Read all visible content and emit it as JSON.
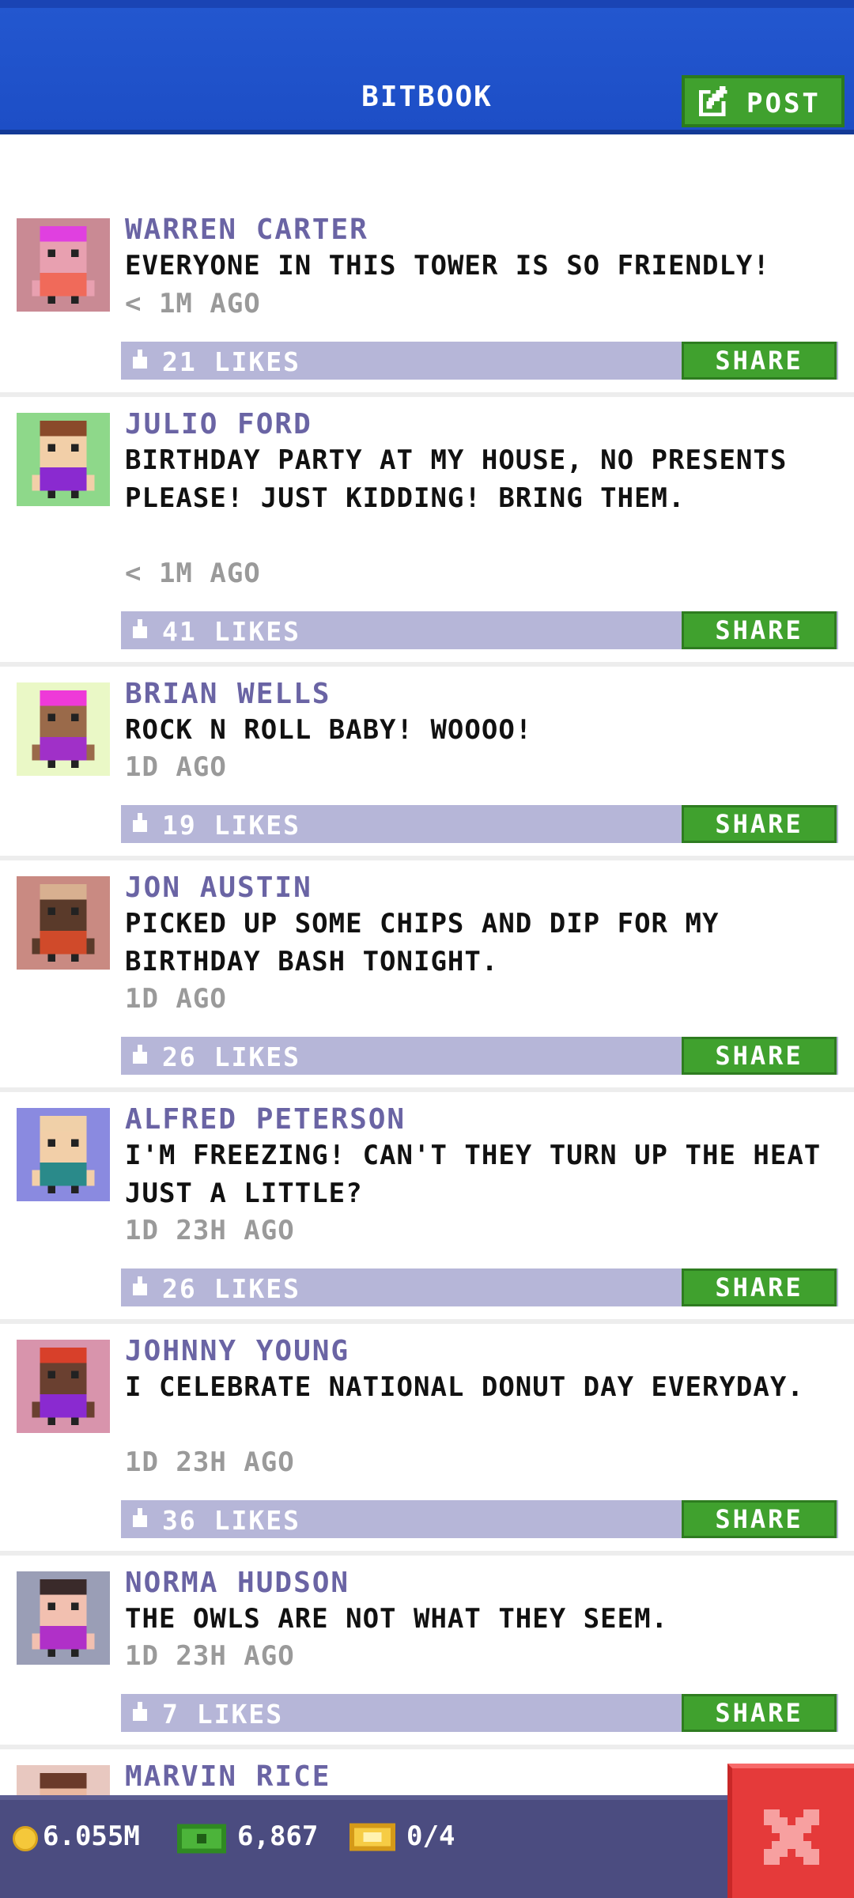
{
  "header": {
    "title": "BITBOOK",
    "post_button_label": "POST"
  },
  "posts": [
    {
      "name": "WARREN CARTER",
      "text": "EVERYONE IN THIS TOWER IS SO FRIENDLY!",
      "time": "< 1M AGO",
      "likes": "21 LIKES",
      "share": "SHARE",
      "avatar_bg": "#c98a94",
      "hair": "#e040e0",
      "shirt": "#f06a5a",
      "skin": "#e8a0b0"
    },
    {
      "name": "JULIO FORD",
      "text": "BIRTHDAY PARTY AT MY HOUSE, NO PRESENTS PLEASE! JUST KIDDING! BRING THEM.",
      "time": "< 1M AGO",
      "likes": "41 LIKES",
      "share": "SHARE",
      "avatar_bg": "#8ed88a",
      "hair": "#8a4a2a",
      "shirt": "#8a2ad0",
      "skin": "#f2cfa8"
    },
    {
      "name": "BRIAN WELLS",
      "text": "ROCK N ROLL BABY! WOOOO!",
      "time": "1D AGO",
      "likes": "19 LIKES",
      "share": "SHARE",
      "avatar_bg": "#eaf8c6",
      "hair": "#ee3ad8",
      "shirt": "#a030c8",
      "skin": "#9a6a4a"
    },
    {
      "name": "JON AUSTIN",
      "text": "PICKED UP SOME CHIPS AND DIP FOR MY BIRTHDAY BASH TONIGHT.",
      "time": "1D AGO",
      "likes": "26 LIKES",
      "share": "SHARE",
      "avatar_bg": "#c98a82",
      "hair": "#d8b090",
      "shirt": "#d04a2a",
      "skin": "#5a3a2a"
    },
    {
      "name": "ALFRED PETERSON",
      "text": "I'M FREEZING! CAN'T THEY TURN UP THE HEAT JUST A LITTLE?",
      "time": "1D 23H AGO",
      "likes": "26 LIKES",
      "share": "SHARE",
      "avatar_bg": "#8a8ae0",
      "hair": "#f0d0a8",
      "shirt": "#2a8a8a",
      "skin": "#f2cfa8"
    },
    {
      "name": "JOHNNY YOUNG",
      "text": "I CELEBRATE NATIONAL DONUT DAY EVERYDAY.",
      "time": "1D 23H AGO",
      "likes": "36 LIKES",
      "share": "SHARE",
      "avatar_bg": "#d894ac",
      "hair": "#d8402a",
      "shirt": "#8a2ad0",
      "skin": "#6a4030"
    },
    {
      "name": "NORMA HUDSON",
      "text": "THE OWLS ARE NOT WHAT THEY SEEM.",
      "time": "1D 23H AGO",
      "likes": "7 LIKES",
      "share": "SHARE",
      "avatar_bg": "#9a9eb6",
      "hair": "#3a2a2a",
      "shirt": "#b030c8",
      "skin": "#f2c0b0"
    },
    {
      "name": "MARVIN RICE",
      "text": "",
      "time": "",
      "likes": "",
      "share": "",
      "avatar_bg": "#e8c8c0",
      "hair": "#6a3a2a",
      "shirt": "#2a6ad0",
      "skin": "#e8b8a0"
    }
  ],
  "footer": {
    "coins": "6.055M",
    "bux": "6,867",
    "tickets": "0/4"
  },
  "colors": {
    "accent_green": "#40a12e",
    "header_blue": "#1d4ec6",
    "name_purple": "#6a64a4",
    "likes_bar": "#b6b6d8",
    "close_red": "#e53a3a"
  }
}
